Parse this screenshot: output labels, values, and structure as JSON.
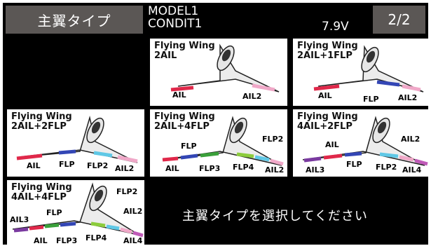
{
  "header": {
    "title": "主翼タイプ",
    "model": "MODEL1",
    "condition": "CONDIT1",
    "voltage": "7.9V",
    "page": "2/2"
  },
  "tiles": [
    {
      "title": "Flying Wing\n2AIL",
      "labels": [
        "AIL",
        "AIL2"
      ]
    },
    {
      "title": "Flying Wing\n2AIL+1FLP",
      "labels": [
        "AIL",
        "FLP",
        "AIL2"
      ]
    },
    {
      "title": "Flying Wing\n2AIL+2FLP",
      "labels": [
        "AIL",
        "FLP",
        "FLP2",
        "AIL2"
      ]
    },
    {
      "title": "Flying Wing\n2AIL+4FLP",
      "labels": [
        "FLP",
        "FLP2",
        "AIL",
        "FLP3",
        "FLP4",
        "AIL2"
      ]
    },
    {
      "title": "Flying Wing\n4AIL+2FLP",
      "labels": [
        "AIL",
        "AIL2",
        "AIL3",
        "FLP",
        "FLP2",
        "AIL4"
      ]
    },
    {
      "title": "Flying Wing\n4AIL+4FLP",
      "labels": [
        "FLP2",
        "AIL3",
        "FLP",
        "AIL2",
        "AIL",
        "FLP3",
        "FLP4",
        "AIL4"
      ]
    }
  ],
  "prompt": "主翼タイプを選択してください",
  "colors": {
    "aileron": "#e0284a",
    "flap": "#3346b5",
    "flap2": "#5fc8e6",
    "aileron2": "#f0a8c8",
    "flap3": "#3aa03a",
    "flap4": "#8ccc3c",
    "aileron3": "#7a3aa0",
    "aileron4": "#c05ab8"
  }
}
